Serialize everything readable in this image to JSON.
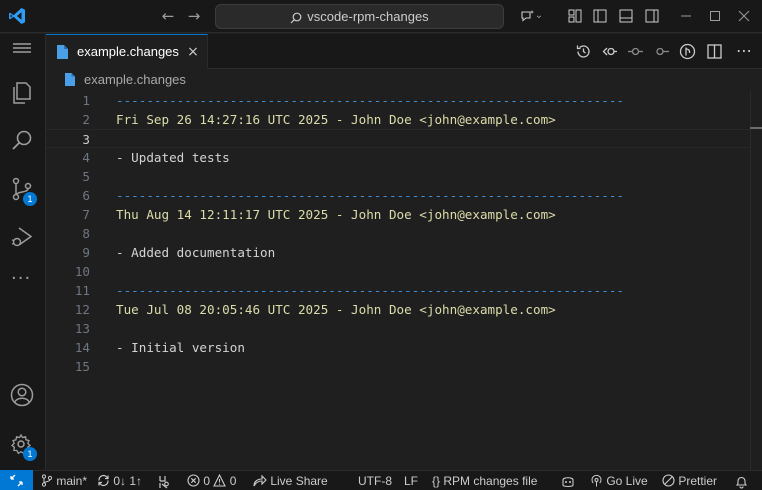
{
  "titlebar": {
    "command_center": "vscode-rpm-changes",
    "icons": [
      "vscode-logo-icon",
      "arrow-left-icon",
      "arrow-right-icon",
      "search-icon",
      "copilot-icon",
      "customize-layout-icon",
      "toggle-primary-sidebar-icon",
      "toggle-panel-icon",
      "toggle-secondary-sidebar-icon",
      "minimize-icon",
      "maximize-icon",
      "close-icon"
    ]
  },
  "activitybar": {
    "items": [
      {
        "name": "explorer",
        "icon": "files-icon"
      },
      {
        "name": "search",
        "icon": "search-icon"
      },
      {
        "name": "source-control",
        "icon": "source-control-icon",
        "badge": "1"
      },
      {
        "name": "run-and-debug",
        "icon": "run-debug-icon"
      },
      {
        "name": "more",
        "icon": "ellipsis-icon"
      }
    ],
    "bottom": [
      {
        "name": "accounts",
        "icon": "account-icon"
      },
      {
        "name": "manage",
        "icon": "gear-icon",
        "badge": "1"
      }
    ]
  },
  "tabs": [
    {
      "label": "example.changes",
      "active": true,
      "close": "×"
    }
  ],
  "breadcrumb": {
    "file": "example.changes"
  },
  "editor": {
    "lines": [
      {
        "n": "1",
        "text": "-------------------------------------------------------------------",
        "kind": "sep"
      },
      {
        "n": "2",
        "text": "Fri Sep 26 14:27:16 UTC 2025 - John Doe <john@example.com>",
        "kind": "header"
      },
      {
        "n": "3",
        "text": "",
        "kind": "item"
      },
      {
        "n": "4",
        "text": "- Updated tests",
        "kind": "item"
      },
      {
        "n": "5",
        "text": "",
        "kind": "item"
      },
      {
        "n": "6",
        "text": "-------------------------------------------------------------------",
        "kind": "sep"
      },
      {
        "n": "7",
        "text": "Thu Aug 14 12:11:17 UTC 2025 - John Doe <john@example.com>",
        "kind": "header"
      },
      {
        "n": "8",
        "text": "",
        "kind": "item"
      },
      {
        "n": "9",
        "text": "- Added documentation",
        "kind": "item"
      },
      {
        "n": "10",
        "text": "",
        "kind": "item"
      },
      {
        "n": "11",
        "text": "-------------------------------------------------------------------",
        "kind": "sep"
      },
      {
        "n": "12",
        "text": "Tue Jul 08 20:05:46 UTC 2025 - John Doe <john@example.com>",
        "kind": "header"
      },
      {
        "n": "13",
        "text": "",
        "kind": "item"
      },
      {
        "n": "14",
        "text": "- Initial version",
        "kind": "item"
      },
      {
        "n": "15",
        "text": "",
        "kind": "item"
      }
    ],
    "active_line": "3"
  },
  "statusbar": {
    "branch": "main*",
    "sync": "0↓ 1↑",
    "problems_errors": "0",
    "problems_warnings": "0",
    "live_share": "Live Share",
    "encoding": "UTF-8",
    "eol": "LF",
    "language": "RPM changes file",
    "go_live": "Go Live",
    "prettier": "Prettier"
  },
  "colors": {
    "accent": "#0078d4",
    "separator_token": "#3f8fd6",
    "header_token": "#dcdcaa",
    "background": "#1f1f1f"
  }
}
